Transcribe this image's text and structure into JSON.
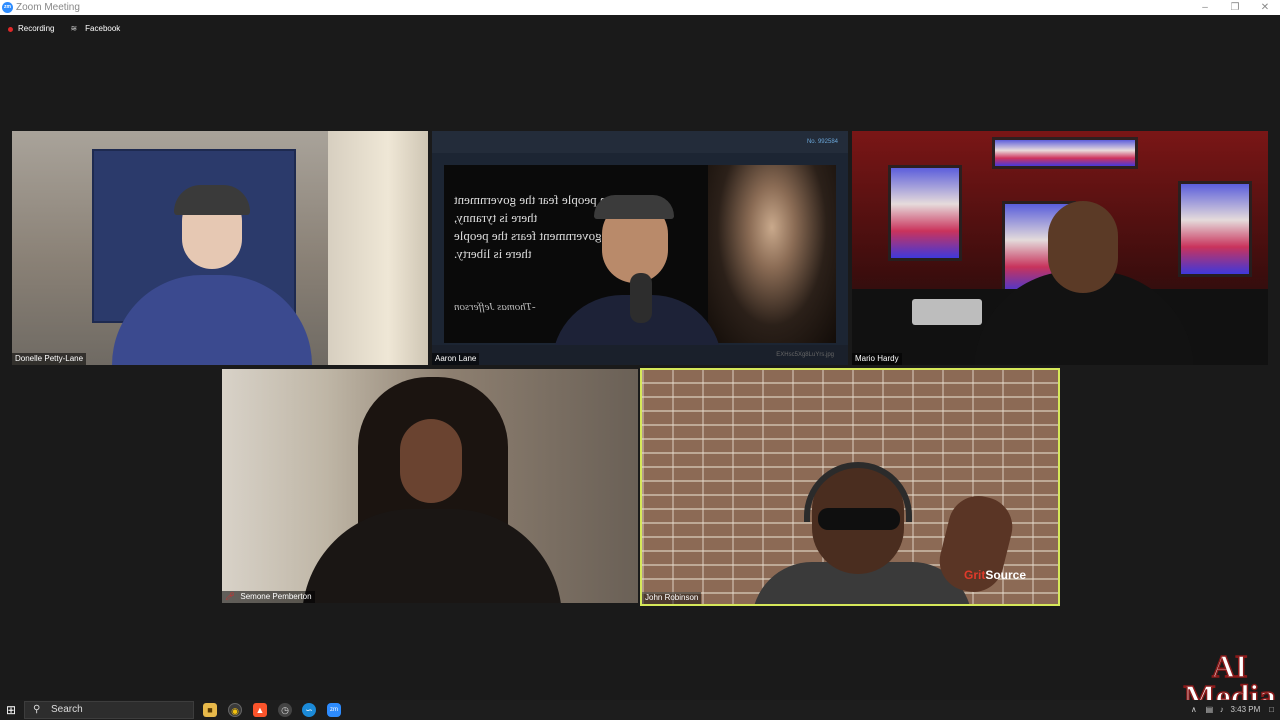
{
  "window": {
    "title": "Zoom Meeting",
    "logo": "zm",
    "controls": [
      "minimize-icon",
      "restore-icon",
      "close-icon"
    ]
  },
  "status": {
    "recording_label": "Recording",
    "live_label": "Facebook"
  },
  "participants": [
    {
      "name": "Donelle Petty-Lane",
      "muted": false,
      "active": false
    },
    {
      "name": "Aaron Lane",
      "muted": false,
      "active": false
    },
    {
      "name": "Mario Hardy",
      "muted": false,
      "active": false
    },
    {
      "name": "Semone Pemberton",
      "muted": true,
      "active": false
    },
    {
      "name": "John Robinson",
      "muted": false,
      "active": true
    }
  ],
  "shared_image": {
    "quote_lines": "When people fear the government\nthere is tyranny,\nwhen the government fears the people\nthere is liberty.",
    "attribution": "-Thomas Jefferson",
    "header_text": "No. 992584",
    "footer_text": "EXHsc5Xg8LuYrs.jpg"
  },
  "tile5_overlay": {
    "logo_prefix": "Grit",
    "logo_suffix": "Source"
  },
  "watermark": {
    "line1": "AI",
    "line2": "Media"
  },
  "taskbar": {
    "search_placeholder": "Search",
    "clock": "3:43 PM"
  },
  "colors": {
    "active_speaker_border": "#d6e85a",
    "recording_dot": "#e02828",
    "zoom_blue": "#2d8cff"
  }
}
